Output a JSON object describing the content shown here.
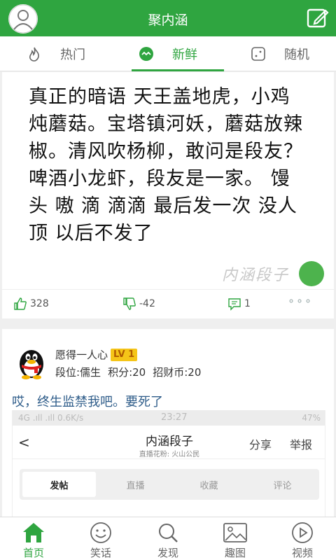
{
  "header": {
    "title": "聚内涵",
    "avatar_icon": "user-avatar-icon",
    "edit_icon": "edit-icon"
  },
  "tabs": [
    {
      "label": "热门",
      "icon": "fire-icon"
    },
    {
      "label": "新鲜",
      "icon": "chat-wave-icon",
      "active": true
    },
    {
      "label": "随机",
      "icon": "dice-icon"
    }
  ],
  "post1": {
    "image_text": "真正的暗语  天王盖地虎，小鸡炖蘑菇。宝塔镇河妖，蘑菇放辣椒。清风吹杨柳，敢问是段友？啤酒小龙虾，段友是一家。  馒头  嗷  滴 滴滴  最后发一次  没人顶  以后不发了",
    "watermark": "内涵段子",
    "likes": "328",
    "dislikes": "-42",
    "comments": "1",
    "more": "∘∘∘"
  },
  "post2": {
    "username": "愿得一人心",
    "level": "LV 1",
    "rank": "段位:儒生",
    "points": "积分:20",
    "coins": "招财币:20",
    "text": "哎，终生监禁我吧。要死了",
    "embedded_screenshot": {
      "status_left": "4G .ıll  .ıll 0.6K/s",
      "status_time": "23:27",
      "status_right": "47%",
      "back": "<",
      "title": "内涵段子",
      "subtitle": "直播花粉: 火山公民",
      "share": "分享",
      "report": "举报",
      "tabs": [
        "发帖",
        "直播",
        "收藏",
        "评论"
      ]
    }
  },
  "bottom_nav": [
    {
      "label": "首页",
      "icon": "home-icon",
      "active": true
    },
    {
      "label": "笑话",
      "icon": "smiley-icon"
    },
    {
      "label": "发现",
      "icon": "search-icon"
    },
    {
      "label": "趣图",
      "icon": "image-icon"
    },
    {
      "label": "视频",
      "icon": "play-icon"
    }
  ],
  "colors": {
    "brand": "#2fa540",
    "link_text": "#2f5d8a",
    "level_badge": "#f5c518"
  }
}
